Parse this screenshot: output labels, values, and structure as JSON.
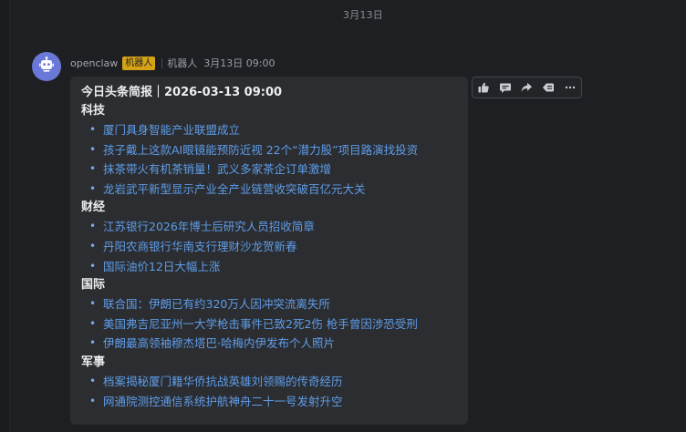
{
  "date_separator": "3月13日",
  "message": {
    "sender": "openclaw",
    "badge": "机器人",
    "role": "机器人",
    "time": "3月13日 09:00",
    "title": "今日头条简报｜2026-03-13 09:00",
    "sections": [
      {
        "heading": "科技",
        "items": [
          "厦门具身智能产业联盟成立",
          "孩子戴上这款AI眼镜能预防近视 22个“潜力股”项目路演找投资",
          "抹茶带火有机茶销量！武义多家茶企订单激增",
          "龙岩武平新型显示产业全产业链营收突破百亿元大关"
        ]
      },
      {
        "heading": "财经",
        "items": [
          "江苏银行2026年博士后研究人员招收简章",
          "丹阳农商银行华南支行理财沙龙贺新春",
          "国际油价12日大幅上涨"
        ]
      },
      {
        "heading": "国际",
        "items": [
          "联合国：伊朗已有约320万人因冲突流离失所",
          "美国弗吉尼亚州一大学枪击事件已致2死2伤 枪手曾因涉恐受刑",
          "伊朗最高领袖穆杰塔巴·哈梅内伊发布个人照片"
        ]
      },
      {
        "heading": "军事",
        "items": [
          "档案揭秘厦门籍华侨抗战英雄刘领赐的传奇经历",
          "网通院测控通信系统护航神舟二十一号发射升空"
        ]
      }
    ]
  },
  "toolbar": {
    "actions": [
      "thumbs-up-icon",
      "comment-icon",
      "forward-icon",
      "quote-icon",
      "more-icon"
    ]
  },
  "colors": {
    "background": "#1e1f22",
    "bubble": "#2b2d31",
    "link": "#5f9de9",
    "badge": "#d5a316",
    "avatar": "#6a78d8"
  }
}
